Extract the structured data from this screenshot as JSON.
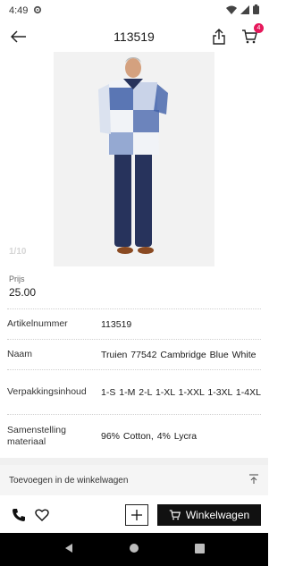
{
  "status_bar": {
    "time": "4:49"
  },
  "app_bar": {
    "title": "113519",
    "cart_count": "4"
  },
  "gallery": {
    "counter": "1/10"
  },
  "price": {
    "label": "Prijs",
    "value": "25.00"
  },
  "specs": [
    {
      "label": "Artikelnummer",
      "value": "113519"
    },
    {
      "label": "Naam",
      "value": "Truien 77542 Cambridge Blue White"
    },
    {
      "label": "Verpakkingsinhoud",
      "value": "1-S 1-M  2-L  1-XL  1-XXL  1-3XL  1-4XL"
    },
    {
      "label": "Samenstelling materiaal",
      "value": "96% Cotton, 4% Lycra"
    }
  ],
  "add_section": {
    "label": "Toevoegen in de winkelwagen"
  },
  "action_bar": {
    "cart_button_label": "Winkelwagen"
  },
  "colors": {
    "badge": "#e6185b",
    "primary_button": "#111111",
    "sweater_blue": "#3f5fa8",
    "trousers_navy": "#27335c"
  }
}
